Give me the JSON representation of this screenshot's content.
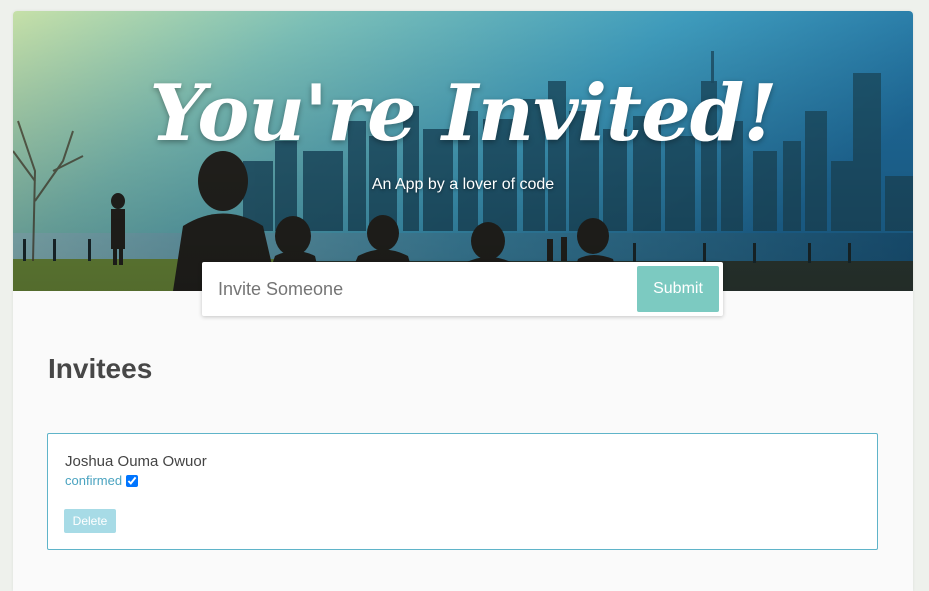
{
  "header": {
    "title": "You're Invited!",
    "subtitle": "An App by a lover of code"
  },
  "invite_form": {
    "placeholder": "Invite Someone",
    "value": "",
    "submit_label": "Submit"
  },
  "invitees_section": {
    "heading": "Invitees",
    "items": [
      {
        "name": "Joshua Ouma Owuor",
        "status_label": "confirmed",
        "confirmed": true,
        "delete_label": "Delete"
      }
    ]
  },
  "colors": {
    "accent": "#7ccac1",
    "card_border": "#5fb4c9",
    "confirmed_text": "#4aa3c0",
    "delete_button": "#a7dbe6",
    "heading_text": "#474747"
  },
  "icons": {
    "confirm_checkbox": "checkbox-checked"
  }
}
